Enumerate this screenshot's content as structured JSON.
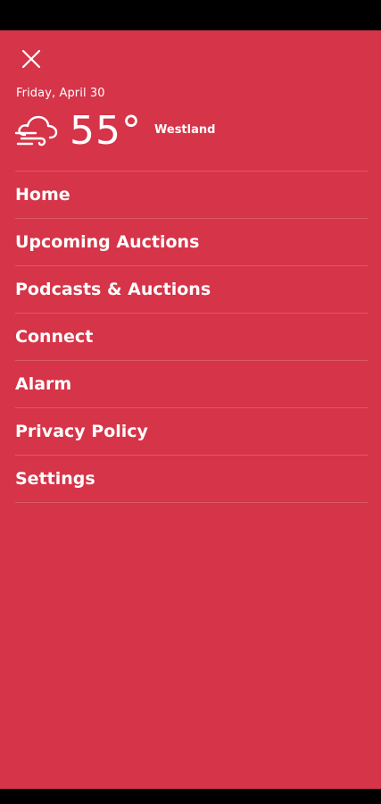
{
  "header": {
    "date": "Friday, April 30",
    "temperature": "55°",
    "location": "Westland",
    "weather_icon": "cloud-wind-icon",
    "close_icon": "close-icon"
  },
  "menu": {
    "items": [
      {
        "label": "Home"
      },
      {
        "label": "Upcoming Auctions"
      },
      {
        "label": "Podcasts & Auctions"
      },
      {
        "label": "Connect"
      },
      {
        "label": "Alarm"
      },
      {
        "label": "Privacy Policy"
      },
      {
        "label": "Settings"
      }
    ]
  },
  "colors": {
    "drawer_background": "#d63448",
    "text": "#ffffff",
    "system_bars": "#000000"
  }
}
